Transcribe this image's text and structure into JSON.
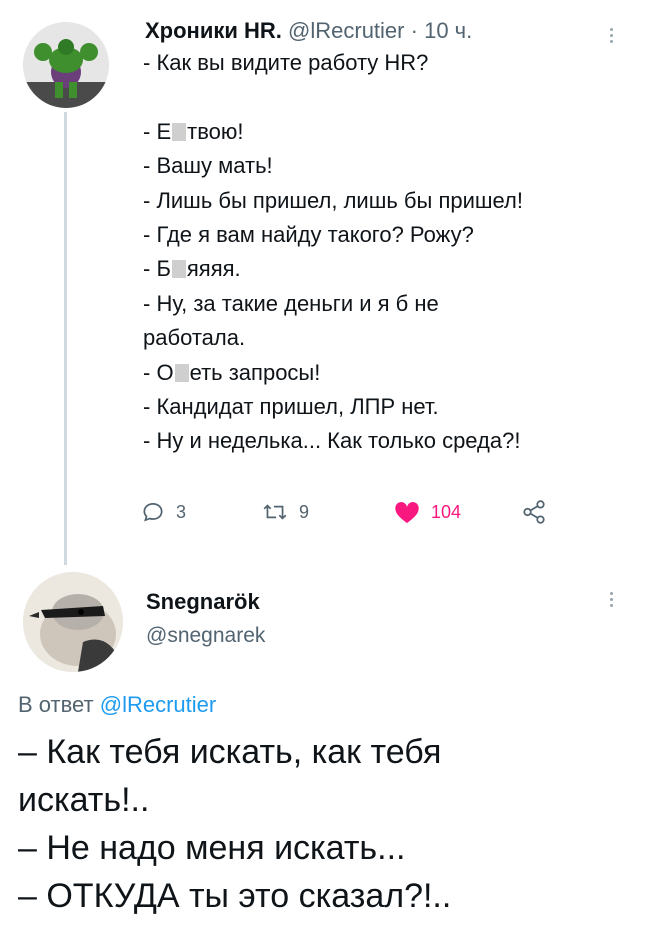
{
  "tweet1": {
    "display_name": "Хроники HR.",
    "handle": "@lRecrutier",
    "separator": "·",
    "time": "10 ч.",
    "lines": [
      "- Как вы видите работу HR?",
      "",
      "- Е",
      "твою!",
      "- Вашу мать!",
      "- Лишь бы пришел, лишь бы пришел!",
      "- Где я вам найду такого? Рожу?",
      "- Б",
      "яяяя.",
      "- Ну, за такие деньги и я б не",
      "работала.",
      "- О",
      "еть запросы!",
      "- Кандидат пришел, ЛПР нет.",
      "- Ну и неделька... Как только среда?!"
    ],
    "actions": {
      "replies": "3",
      "retweets": "9",
      "likes": "104"
    }
  },
  "tweet2": {
    "display_name": "Snegnarök",
    "handle": "@snegnarek",
    "reply_prefix": "В ответ",
    "reply_mention": "@lRecrutier",
    "lines": [
      "– Как тебя искать, как тебя",
      "искать!..",
      "– Не надо меня искать...",
      "– ОТКУДА ты это сказал?!.."
    ]
  },
  "icons": {
    "reply": "speech-bubble-icon",
    "retweet": "retweet-arrows-icon",
    "like": "heart-filled-icon",
    "share": "share-nodes-icon",
    "more": "vertical-dots-icon"
  },
  "colors": {
    "like": "#f91880",
    "mention": "#1d9bf0",
    "muted": "#536471",
    "text": "#0f1419"
  }
}
